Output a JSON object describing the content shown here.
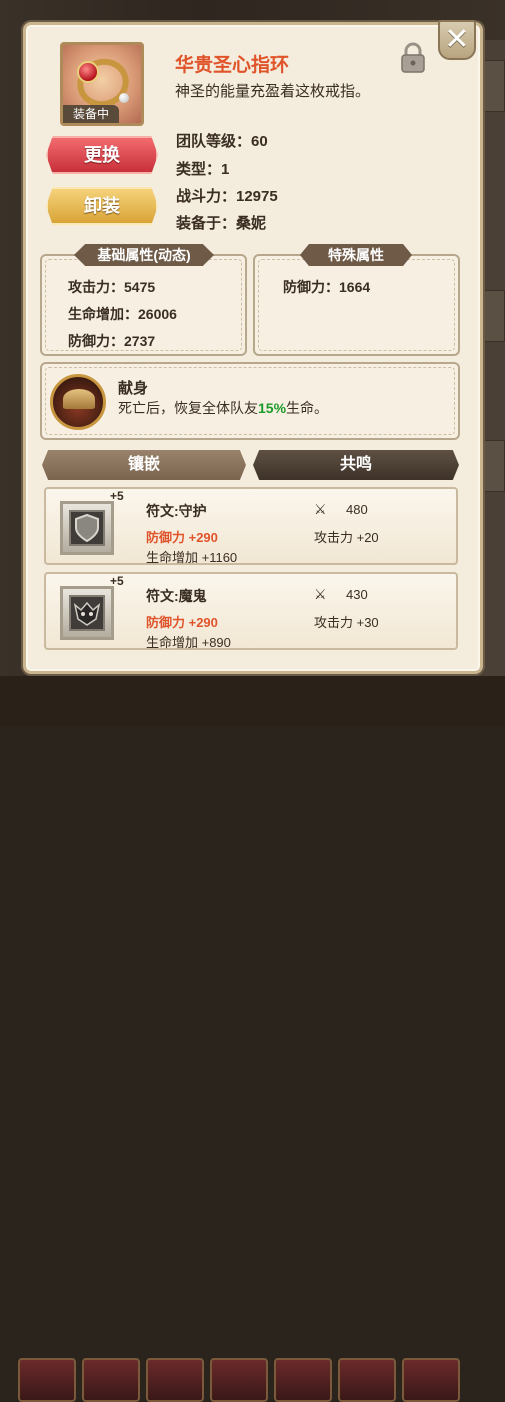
{
  "item": {
    "name": "华贵圣心指环",
    "description": "神圣的能量充盈着这枚戒指。",
    "equipped_badge": "装备中",
    "icon": "ring-icon"
  },
  "buttons": {
    "replace": "更换",
    "unequip": "卸装",
    "close": "✕"
  },
  "info": {
    "team_level": "团队等级：60",
    "type": "类型：1",
    "power": "战斗力：12975",
    "equipped_by": "装备于：桑妮"
  },
  "basic_attrs": {
    "title": "基础属性(动态)",
    "items": [
      "攻击力：5475",
      "生命增加：26006",
      "防御力：2737"
    ]
  },
  "special_attrs": {
    "title": "特殊属性",
    "items": [
      "防御力：1664"
    ]
  },
  "skill": {
    "name": "献身",
    "desc_pre": "死亡后，恢复全体队友",
    "desc_highlight": "15%",
    "desc_post": "生命。"
  },
  "tabs": [
    "镶嵌",
    "共鸣"
  ],
  "runes": [
    {
      "level": "+5",
      "name": "符文:守护",
      "main": "防御力 +290",
      "sub": "生命增加 +1160",
      "power": "480",
      "sub2": "攻击力 +20",
      "icon": "shield-rune-icon"
    },
    {
      "level": "+5",
      "name": "符文:魔鬼",
      "main": "防御力 +290",
      "sub": "生命增加 +890",
      "power": "430",
      "sub2": "攻击力 +30",
      "icon": "demon-rune-icon"
    }
  ],
  "colors": {
    "title": "#e0542b",
    "highlight": "#1c9a2a",
    "replace_button": "#d83c44",
    "unequip_button": "#e3b14a"
  }
}
